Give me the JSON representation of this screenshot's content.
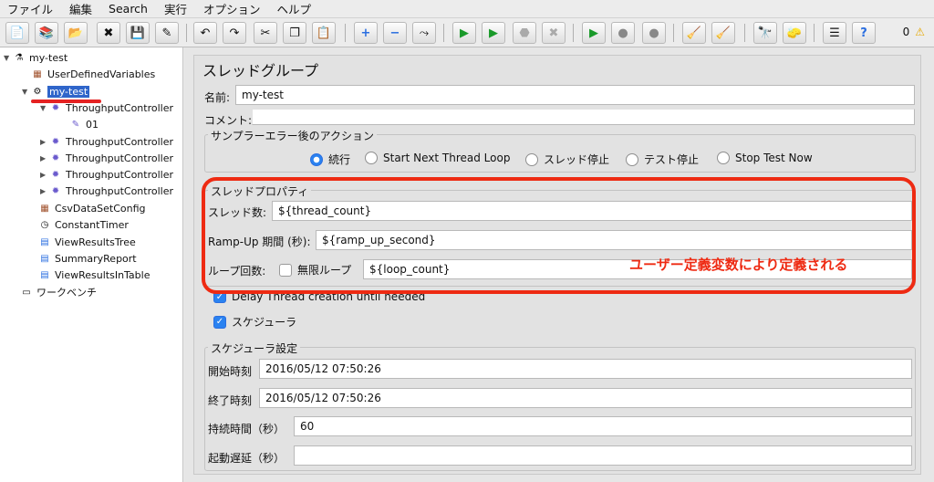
{
  "menu": [
    "ファイル",
    "編集",
    "Search",
    "実行",
    "オプション",
    "ヘルプ"
  ],
  "toolbar": {
    "icons": [
      "new-icon",
      "templates-icon",
      "open-icon",
      "close-icon",
      "save-icon",
      "save-as-icon",
      "undo-icon",
      "redo-icon",
      "cut-icon",
      "copy-icon",
      "paste-icon",
      "expand-icon",
      "collapse-icon",
      "toggle-icon",
      "start-icon",
      "start-no-pause-icon",
      "stop-icon",
      "shutdown-icon",
      "remote-start-icon",
      "remote-stop-icon",
      "remote-shutdown-icon",
      "clear-icon",
      "clear-all-icon",
      "search-icon",
      "reset-search-icon",
      "function-helper-icon",
      "help-icon"
    ],
    "error_count": "0"
  },
  "tree": {
    "root": "my-test",
    "items": [
      "UserDefinedVariables",
      "my-test",
      "ThroughputController",
      "01",
      "ThroughputController",
      "ThroughputController",
      "ThroughputController",
      "ThroughputController",
      "CsvDataSetConfig",
      "ConstantTimer",
      "ViewResultsTree",
      "SummaryReport",
      "ViewResultsInTable"
    ],
    "workbench": "ワークベンチ"
  },
  "form": {
    "title": "スレッドグループ",
    "name_label": "名前:",
    "name_value": "my-test",
    "comment_label": "コメント:",
    "error_action": {
      "legend": "サンプラーエラー後のアクション",
      "options": [
        "続行",
        "Start Next Thread Loop",
        "スレッド停止",
        "テスト停止",
        "Stop Test Now"
      ]
    },
    "thread_props": {
      "legend": "スレッドプロパティ",
      "threads_label": "スレッド数:",
      "threads_value": "${thread_count}",
      "rampup_label": "Ramp-Up 期間 (秒):",
      "rampup_value": "${ramp_up_second}",
      "loop_label": "ループ回数:",
      "infinite_label": "無限ループ",
      "loop_value": "${loop_count}"
    },
    "delay_label": "Delay Thread creation until needed",
    "scheduler_label": "スケジューラ",
    "scheduler": {
      "legend": "スケジューラ設定",
      "start_label": "開始時刻",
      "start_value": "2016/05/12 07:50:26",
      "end_label": "終了時刻",
      "end_value": "2016/05/12 07:50:26",
      "duration_label": "持続時間（秒）",
      "duration_value": "60",
      "delay_label": "起動遅延（秒）",
      "delay_value": ""
    }
  },
  "annotation": "ユーザー定義変数により定義される",
  "colors": {
    "annotation": "#ee2a12",
    "selection": "#2f65ca",
    "accent": "#2a82f0"
  }
}
